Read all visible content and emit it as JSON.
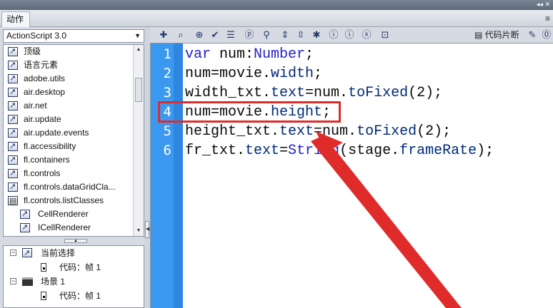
{
  "titlebar": {
    "close_glyph": "◂◂ ✕"
  },
  "tabs": {
    "active_label": "动作",
    "menu_glyph": "≡"
  },
  "left_panel": {
    "version_select": "ActionScript 3.0",
    "library_items": [
      {
        "label": "顶级",
        "icon": "class-link-icon",
        "indent": 0
      },
      {
        "label": "语言元素",
        "icon": "class-link-icon",
        "indent": 0
      },
      {
        "label": "adobe.utils",
        "icon": "class-link-icon",
        "indent": 0
      },
      {
        "label": "air.desktop",
        "icon": "class-link-icon",
        "indent": 0
      },
      {
        "label": "air.net",
        "icon": "class-link-icon",
        "indent": 0
      },
      {
        "label": "air.update",
        "icon": "class-link-icon",
        "indent": 0
      },
      {
        "label": "air.update.events",
        "icon": "class-link-icon",
        "indent": 0
      },
      {
        "label": "fl.accessibility",
        "icon": "class-link-icon",
        "indent": 0
      },
      {
        "label": "fl.containers",
        "icon": "class-link-icon",
        "indent": 0
      },
      {
        "label": "fl.controls",
        "icon": "class-link-icon",
        "indent": 0
      },
      {
        "label": "fl.controls.dataGridCla...",
        "icon": "class-link-icon",
        "indent": 0
      },
      {
        "label": "fl.controls.listClasses",
        "icon": "book-icon",
        "indent": 0
      },
      {
        "label": "CellRenderer",
        "icon": "class-link-icon",
        "indent": 1
      },
      {
        "label": "ICellRenderer",
        "icon": "class-link-icon",
        "indent": 1
      }
    ],
    "scene_tree": [
      {
        "label": "当前选择",
        "node": "link",
        "expander": "⊟"
      },
      {
        "label": "代码：帧 1",
        "node": "doc",
        "expander": ""
      },
      {
        "label": "场景 1",
        "node": "clap",
        "expander": "⊟"
      },
      {
        "label": "代码：帧 1",
        "node": "doc",
        "expander": ""
      }
    ]
  },
  "toolbar": {
    "buttons": [
      {
        "name": "add-statement-icon",
        "glyph": "✚"
      },
      {
        "name": "find-icon",
        "glyph": "⌕"
      },
      {
        "name": "target-path-icon",
        "glyph": "⊕"
      },
      {
        "name": "check-syntax-icon",
        "glyph": "✔"
      },
      {
        "name": "auto-format-icon",
        "glyph": "☰"
      },
      {
        "name": "code-hint-icon",
        "glyph": "ⓟ"
      },
      {
        "name": "debug-options-icon",
        "glyph": "⚲"
      },
      {
        "name": "collapse-between-braces-icon",
        "glyph": "⇕"
      },
      {
        "name": "collapse-selection-icon",
        "glyph": "⇳"
      },
      {
        "name": "expand-all-icon",
        "glyph": "✱"
      },
      {
        "name": "apply-block-comment-icon",
        "glyph": "ⓘ"
      },
      {
        "name": "apply-line-comment-icon",
        "glyph": "ⓘ"
      },
      {
        "name": "remove-comment-icon",
        "glyph": "ⓧ"
      },
      {
        "name": "show-hide-toolbox-icon",
        "glyph": "⊡"
      }
    ],
    "snippets_label": "代码片断",
    "wand_glyph": "✎",
    "help_glyph": "⓪"
  },
  "editor": {
    "line_numbers": [
      "1",
      "2",
      "3",
      "4",
      "5",
      "6"
    ],
    "lines": [
      [
        {
          "t": "var",
          "c": "kw"
        },
        {
          "t": " num:",
          "c": ""
        },
        {
          "t": "Number",
          "c": "ty"
        },
        {
          "t": ";",
          "c": ""
        }
      ],
      [
        {
          "t": "num=movie.",
          "c": ""
        },
        {
          "t": "width",
          "c": "prop"
        },
        {
          "t": ";",
          "c": ""
        }
      ],
      [
        {
          "t": "width_txt.",
          "c": ""
        },
        {
          "t": "text",
          "c": "prop"
        },
        {
          "t": "=num.",
          "c": ""
        },
        {
          "t": "toFixed",
          "c": "prop"
        },
        {
          "t": "(2);",
          "c": ""
        }
      ],
      [
        {
          "t": "num=movie.",
          "c": ""
        },
        {
          "t": "height",
          "c": "prop"
        },
        {
          "t": ";",
          "c": ""
        }
      ],
      [
        {
          "t": "height_txt.",
          "c": ""
        },
        {
          "t": "text",
          "c": "prop"
        },
        {
          "t": "=num.",
          "c": ""
        },
        {
          "t": "toFixed",
          "c": "prop"
        },
        {
          "t": "(2);",
          "c": ""
        }
      ],
      [
        {
          "t": "fr_txt.",
          "c": ""
        },
        {
          "t": "text",
          "c": "prop"
        },
        {
          "t": "=",
          "c": ""
        },
        {
          "t": "String",
          "c": "ty"
        },
        {
          "t": "(stage.",
          "c": ""
        },
        {
          "t": "frameRate",
          "c": "prop"
        },
        {
          "t": ");",
          "c": ""
        }
      ]
    ],
    "highlight_line": 4,
    "annotation_color": "#e02b2b",
    "gutter_color": "#3a98ee"
  }
}
